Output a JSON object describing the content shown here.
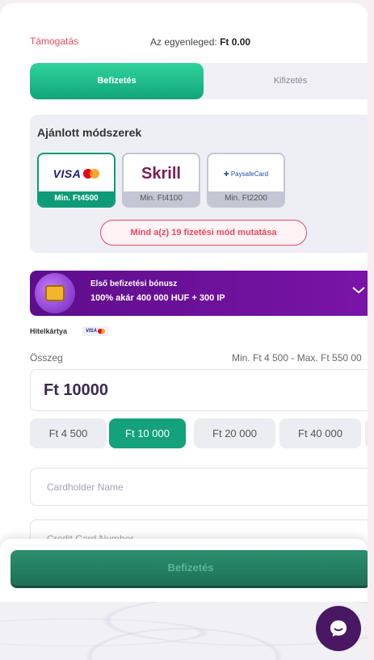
{
  "header": {
    "support_link": "Támogatás",
    "balance_label": "Az egyenleged:",
    "balance_value": "Ft 0.00"
  },
  "tabs": [
    {
      "label": "Befizetés",
      "active": true
    },
    {
      "label": "Kifizetés",
      "active": false
    }
  ],
  "recommended": {
    "title": "Ajánlott módszerek",
    "methods": [
      {
        "name": "visa-mastercard",
        "logo_text": "VISA",
        "min": "Min. Ft4500",
        "selected": true
      },
      {
        "name": "skrill",
        "logo_text": "Skrill",
        "min": "Min. Ft4100",
        "selected": false
      },
      {
        "name": "paysafecard",
        "logo_text": "PaysafeCard",
        "min": "Min. Ft2200",
        "selected": false
      }
    ],
    "show_all_label": "Mind a(z) 19 fizetési mód mutatása"
  },
  "bonus": {
    "title": "Első befizetési bónusz",
    "offer": "100% akár 400 000 HUF + 300 IP"
  },
  "credit_card": {
    "label": "Hitelkártya",
    "mini_logo": "VISA"
  },
  "amount": {
    "label": "Összeg",
    "range": "Min. Ft 4 500 - Max. Ft 550 00",
    "value": "Ft 10000",
    "presets": [
      {
        "label": "Ft 4 500",
        "active": false
      },
      {
        "label": "Ft 10 000",
        "active": true
      },
      {
        "label": "Ft 20 000",
        "active": false
      },
      {
        "label": "Ft 40 000",
        "active": false
      }
    ]
  },
  "form": {
    "cardholder_placeholder": "Cardholder Name",
    "card_number_placeholder": "Credit Card Number"
  },
  "submit_label": "Befizetés",
  "colors": {
    "accent_green": "#14a17b",
    "brand_purple": "#5e0e8a",
    "link_red": "#e84a5f"
  }
}
